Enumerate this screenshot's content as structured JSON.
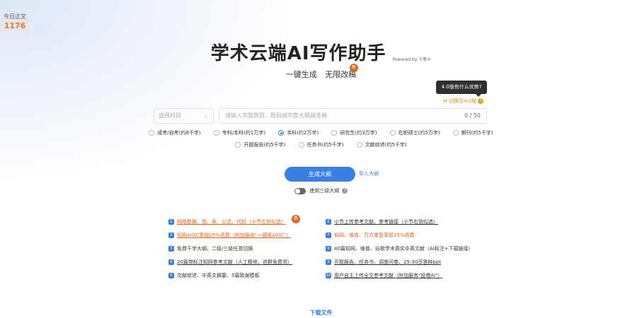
{
  "today": {
    "label": "今日正文",
    "count": "1176"
  },
  "header": {
    "title": "学术云端AI写作助手",
    "powered_by": "Powered by 千笔®",
    "subtitle_left": "一键生成",
    "subtitle_right": "无限改稿",
    "new_badge": "新"
  },
  "version": {
    "tooltip": "4.0版有什么优势?",
    "switch_label": "⇄ 切换至4.0版",
    "help": "?"
  },
  "form": {
    "subject_placeholder": "选择科目",
    "topic_placeholder": "请输入完整题目，题目越完整大纲越准确",
    "topic_count": "0 / 50"
  },
  "paper_types_row1": [
    {
      "label": "成考/自考(约8千字)",
      "selected": false
    },
    {
      "label": "专科/本科(约1万字)",
      "selected": false
    },
    {
      "label": "本科(约2万字)",
      "selected": true
    },
    {
      "label": "研究生(约3万字)",
      "selected": false
    },
    {
      "label": "在职硕士(约5万字)",
      "selected": false
    },
    {
      "label": "期刊(约5千字)",
      "selected": false
    }
  ],
  "paper_types_row2": [
    {
      "label": "开题报告(约5千字)",
      "selected": false
    },
    {
      "label": "任务书(约5千字)",
      "selected": false
    },
    {
      "label": "文献综述(约5千字)",
      "selected": false
    }
  ],
  "actions": {
    "generate": "生成大纲",
    "import": "导入大纲",
    "three_level": "使用三级大纲",
    "help": "?"
  },
  "features_left": [
    {
      "num": "1",
      "text": "网络数据、图、表、公式、代码（小节右侧勾选）",
      "style": "orange link"
    },
    {
      "num": "2",
      "text": "知网AIGC率超25%退费（附加服务\"一键降AIGC\"）",
      "style": "orange link"
    },
    {
      "num": "3",
      "text": "免费千字大纲、二级/三级任意切换",
      "style": ""
    },
    {
      "num": "4",
      "text": "20篇带标注知网参考文献（人工精修，进群免费领）",
      "style": "link"
    },
    {
      "num": "5",
      "text": "文献综述、中英文摘要、5篇致谢模板",
      "style": ""
    }
  ],
  "features_right": [
    {
      "num": "6",
      "text": "小节上传参考文献、参考链接（小节右侧勾选）",
      "style": "link"
    },
    {
      "num": "7",
      "text": "知网、维普、万方重复率超15%退费",
      "style": "orange"
    },
    {
      "num": "8",
      "text": "40篇知网、维普、谷歌学术真实中英文献（AI标注+下载链接）",
      "style": ""
    },
    {
      "num": "9",
      "text": "开题报告、任务书、调查问卷、25-30页答辩ppt",
      "style": "link"
    },
    {
      "num": "10",
      "text": "用户自主上传全文参考文献（附加服务\"投喂AI\"）",
      "style": "link"
    }
  ],
  "download": "下载文件",
  "colors": {
    "accent": "#3a7fe5",
    "orange": "#e0651f",
    "switch": "#e08a1e"
  }
}
